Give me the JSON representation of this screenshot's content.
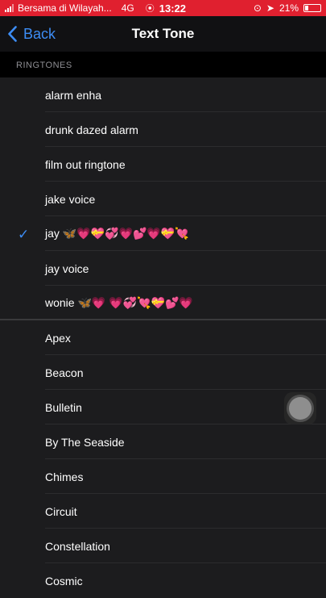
{
  "status_bar": {
    "carrier": "Bersama di Wilayah...",
    "network": "4G",
    "time": "13:22",
    "battery": "21%",
    "battery_level": 0.21
  },
  "nav": {
    "back_label": "Back",
    "title": "Text Tone"
  },
  "ringtones_header": "RINGTONES",
  "custom_tones": [
    {
      "label": "alarm enha"
    },
    {
      "label": "drunk dazed alarm"
    },
    {
      "label": "film out ringtone"
    },
    {
      "label": "jake voice"
    },
    {
      "label": "jay 🦋💗💝💞💗💕💗💝💘",
      "selected": true
    },
    {
      "label": "jay voice"
    },
    {
      "label": "wonie 🦋💗 💗💞💘💝💕💗"
    }
  ],
  "system_tones": [
    {
      "label": "Apex"
    },
    {
      "label": "Beacon"
    },
    {
      "label": "Bulletin"
    },
    {
      "label": "By The Seaside"
    },
    {
      "label": "Chimes"
    },
    {
      "label": "Circuit"
    },
    {
      "label": "Constellation"
    },
    {
      "label": "Cosmic"
    }
  ],
  "colors": {
    "accent": "#3d8df5",
    "status_bar": "#e0202f"
  }
}
